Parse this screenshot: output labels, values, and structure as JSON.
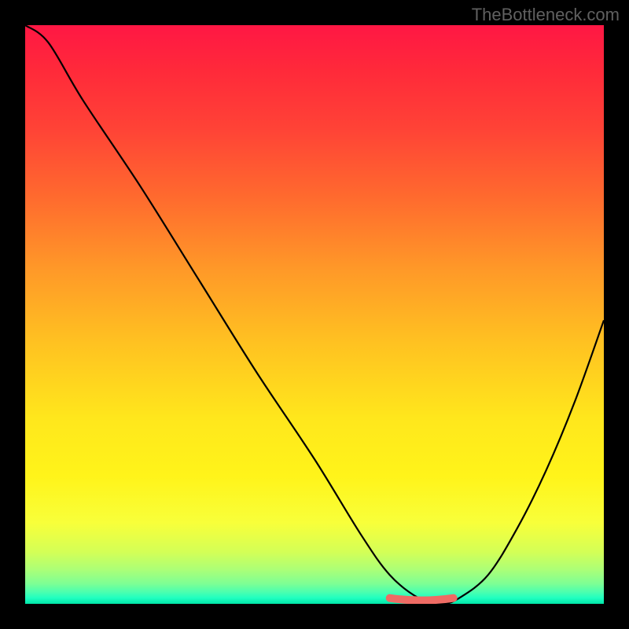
{
  "watermark": "TheBottleneck.com",
  "chart_data": {
    "type": "line",
    "title": "",
    "xlabel": "",
    "ylabel": "",
    "xlim": [
      0,
      100
    ],
    "ylim": [
      0,
      100
    ],
    "grid": false,
    "series": [
      {
        "name": "bottleneck-curve",
        "x": [
          0,
          4,
          10,
          20,
          30,
          40,
          50,
          58,
          63,
          68,
          72,
          75,
          80,
          85,
          90,
          95,
          100
        ],
        "values": [
          100,
          97,
          87,
          72,
          56,
          40,
          25,
          12,
          5,
          1,
          0,
          1,
          5,
          13,
          23,
          35,
          49
        ]
      }
    ],
    "marker": {
      "name": "optimal-region",
      "x": [
        63,
        74
      ],
      "y": [
        1.0,
        1.0
      ]
    },
    "gradient_colors": {
      "top": "#ff1744",
      "mid_high": "#ff9828",
      "mid": "#ffe71c",
      "mid_low": "#d4ff56",
      "bottom": "#00e5a8"
    }
  }
}
